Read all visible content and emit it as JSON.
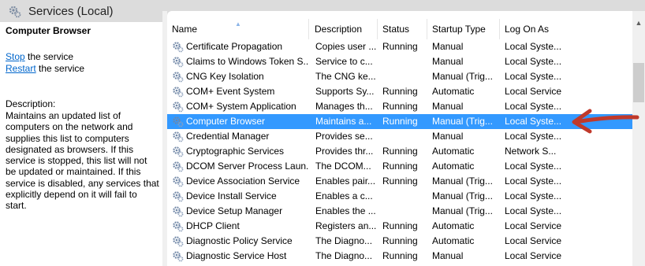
{
  "window": {
    "title": "Services (Local)"
  },
  "detail": {
    "service_name": "Computer Browser",
    "stop_link": "Stop",
    "stop_suffix": " the service",
    "restart_link": "Restart",
    "restart_suffix": " the service",
    "description_label": "Description:",
    "description": "Maintains an updated list of computers on the network and supplies this list to computers designated as browsers. If this service is stopped, this list will not be updated or maintained. If this service is disabled, any services that explicitly depend on it will fail to start."
  },
  "columns": {
    "name": "Name",
    "description": "Description",
    "status": "Status",
    "startup_type": "Startup Type",
    "log_on_as": "Log On As"
  },
  "rows": [
    {
      "name": "Certificate Propagation",
      "description": "Copies user ...",
      "status": "Running",
      "startup": "Manual",
      "logon": "Local Syste..."
    },
    {
      "name": "Claims to Windows Token S...",
      "description": "Service to c...",
      "status": "",
      "startup": "Manual",
      "logon": "Local Syste..."
    },
    {
      "name": "CNG Key Isolation",
      "description": "The CNG ke...",
      "status": "",
      "startup": "Manual (Trig...",
      "logon": "Local Syste..."
    },
    {
      "name": "COM+ Event System",
      "description": "Supports Sy...",
      "status": "Running",
      "startup": "Automatic",
      "logon": "Local Service"
    },
    {
      "name": "COM+ System Application",
      "description": "Manages th...",
      "status": "Running",
      "startup": "Manual",
      "logon": "Local Syste..."
    },
    {
      "name": "Computer Browser",
      "description": "Maintains a...",
      "status": "Running",
      "startup": "Manual (Trig...",
      "logon": "Local Syste...",
      "selected": true
    },
    {
      "name": "Credential Manager",
      "description": "Provides se...",
      "status": "",
      "startup": "Manual",
      "logon": "Local Syste..."
    },
    {
      "name": "Cryptographic Services",
      "description": "Provides thr...",
      "status": "Running",
      "startup": "Automatic",
      "logon": "Network S..."
    },
    {
      "name": "DCOM Server Process Laun...",
      "description": "The DCOM...",
      "status": "Running",
      "startup": "Automatic",
      "logon": "Local Syste..."
    },
    {
      "name": "Device Association Service",
      "description": "Enables pair...",
      "status": "Running",
      "startup": "Manual (Trig...",
      "logon": "Local Syste..."
    },
    {
      "name": "Device Install Service",
      "description": "Enables a c...",
      "status": "",
      "startup": "Manual (Trig...",
      "logon": "Local Syste..."
    },
    {
      "name": "Device Setup Manager",
      "description": "Enables the ...",
      "status": "",
      "startup": "Manual (Trig...",
      "logon": "Local Syste..."
    },
    {
      "name": "DHCP Client",
      "description": "Registers an...",
      "status": "Running",
      "startup": "Automatic",
      "logon": "Local Service"
    },
    {
      "name": "Diagnostic Policy Service",
      "description": "The Diagno...",
      "status": "Running",
      "startup": "Automatic",
      "logon": "Local Service"
    },
    {
      "name": "Diagnostic Service Host",
      "description": "The Diagno...",
      "status": "Running",
      "startup": "Manual",
      "logon": "Local Service"
    }
  ],
  "colors": {
    "selection": "#3399ff",
    "arrow": "#c0392b",
    "link": "#0066cc"
  },
  "icons": {
    "service": "gear-icon",
    "pointer": "red-arrow"
  }
}
